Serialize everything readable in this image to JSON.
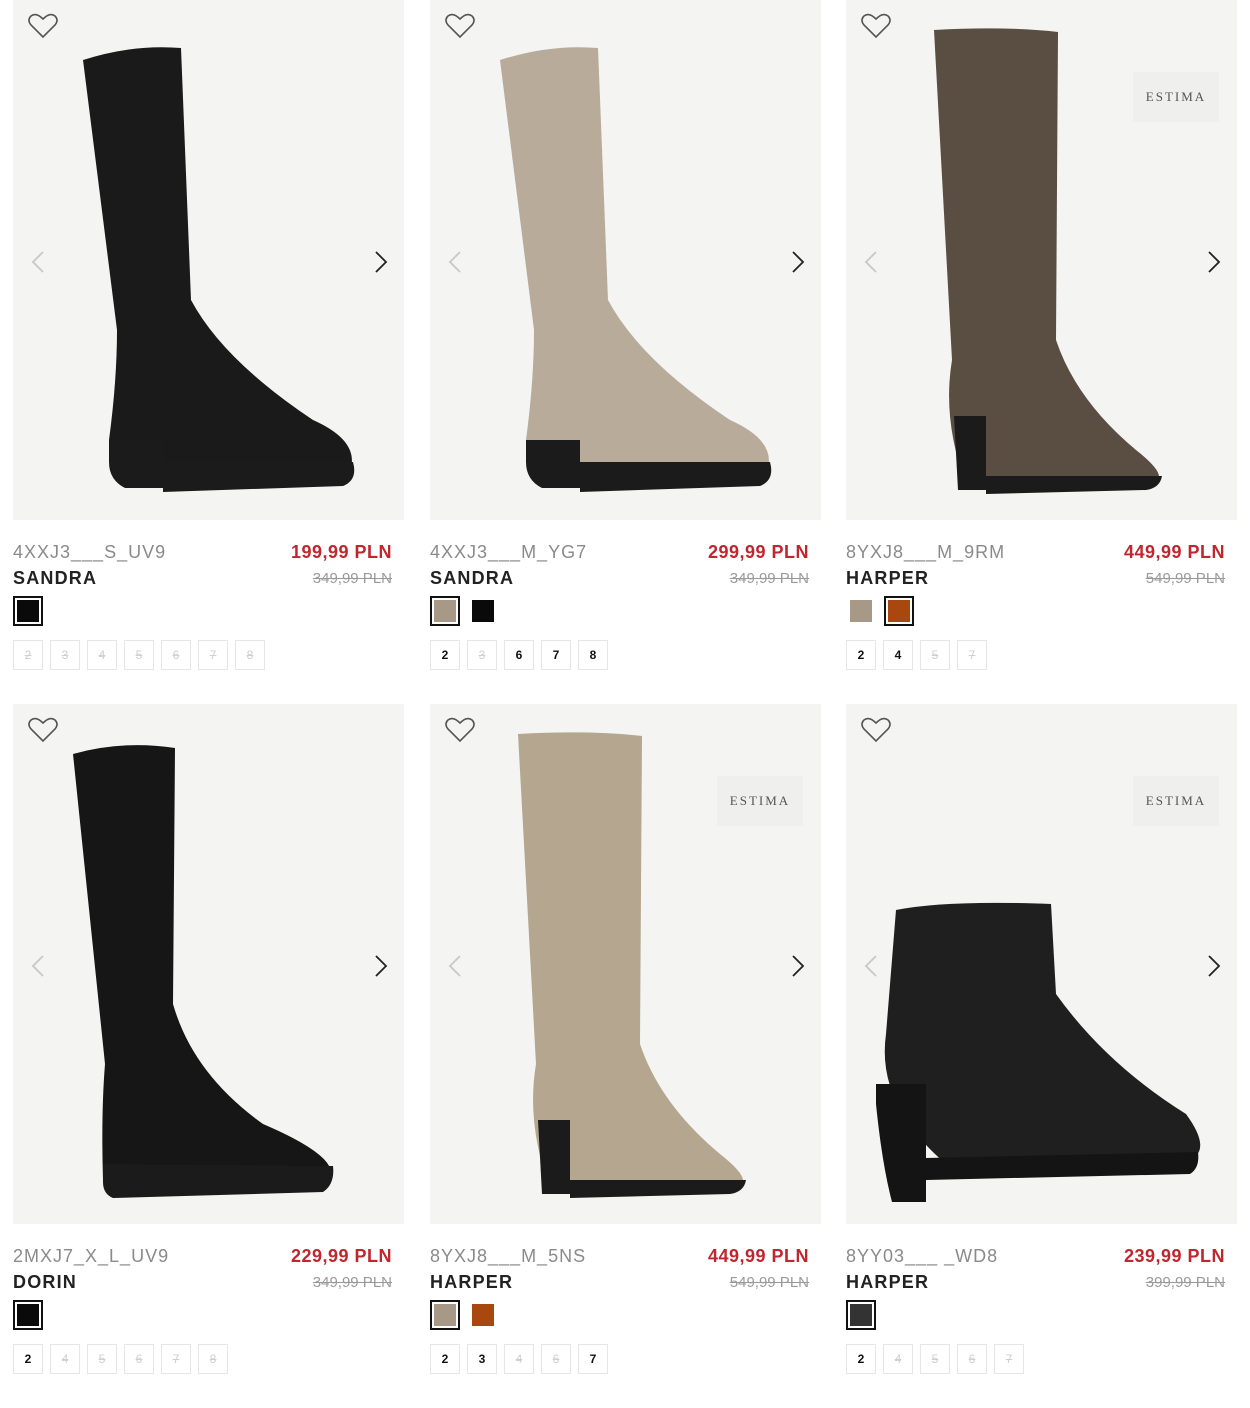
{
  "products": [
    {
      "sku": "4XXJ3___S_UV9",
      "name": "SANDRA",
      "price": "199,99 PLN",
      "old_price": "349,99 PLN",
      "brand_badge": "",
      "boot_color": "#1a1a1a",
      "boot_type": "block-stretch",
      "swatches": [
        {
          "color": "#0a0a0a",
          "selected": true
        }
      ],
      "sizes": [
        {
          "label": "2",
          "available": false
        },
        {
          "label": "3",
          "available": false
        },
        {
          "label": "4",
          "available": false
        },
        {
          "label": "5",
          "available": false
        },
        {
          "label": "6",
          "available": false
        },
        {
          "label": "7",
          "available": false
        },
        {
          "label": "8",
          "available": false
        }
      ]
    },
    {
      "sku": "4XXJ3___M_YG7",
      "name": "SANDRA",
      "price": "299,99 PLN",
      "old_price": "349,99 PLN",
      "brand_badge": "",
      "boot_color": "#b9ab9a",
      "boot_type": "block-stretch",
      "swatches": [
        {
          "color": "#a89986",
          "selected": true
        },
        {
          "color": "#0a0a0a",
          "selected": false
        }
      ],
      "sizes": [
        {
          "label": "2",
          "available": true
        },
        {
          "label": "3",
          "available": false
        },
        {
          "label": "6",
          "available": true
        },
        {
          "label": "7",
          "available": true
        },
        {
          "label": "8",
          "available": true
        }
      ]
    },
    {
      "sku": "8YXJ8___M_9RM",
      "name": "HARPER",
      "price": "449,99 PLN",
      "old_price": "549,99 PLN",
      "brand_badge": "ESTIMA",
      "boot_color": "#5a4d42",
      "boot_type": "heel-tall",
      "swatches": [
        {
          "color": "#a89986",
          "selected": false
        },
        {
          "color": "#a8480e",
          "selected": true
        }
      ],
      "sizes": [
        {
          "label": "2",
          "available": true
        },
        {
          "label": "4",
          "available": true
        },
        {
          "label": "5",
          "available": false
        },
        {
          "label": "7",
          "available": false
        }
      ]
    },
    {
      "sku": "2MXJ7_X_L_UV9",
      "name": "DORIN",
      "price": "229,99 PLN",
      "old_price": "349,99 PLN",
      "brand_badge": "",
      "boot_color": "#161616",
      "boot_type": "flat-stretch",
      "swatches": [
        {
          "color": "#0a0a0a",
          "selected": true
        }
      ],
      "sizes": [
        {
          "label": "2",
          "available": true
        },
        {
          "label": "4",
          "available": false
        },
        {
          "label": "5",
          "available": false
        },
        {
          "label": "6",
          "available": false
        },
        {
          "label": "7",
          "available": false
        },
        {
          "label": "8",
          "available": false
        }
      ]
    },
    {
      "sku": "8YXJ8___M_5NS",
      "name": "HARPER",
      "price": "449,99 PLN",
      "old_price": "549,99 PLN",
      "brand_badge": "ESTIMA",
      "boot_color": "#b4a68f",
      "boot_type": "heel-tall",
      "swatches": [
        {
          "color": "#a89986",
          "selected": true
        },
        {
          "color": "#a8480e",
          "selected": false
        }
      ],
      "sizes": [
        {
          "label": "2",
          "available": true
        },
        {
          "label": "3",
          "available": true
        },
        {
          "label": "4",
          "available": false
        },
        {
          "label": "6",
          "available": false
        },
        {
          "label": "7",
          "available": true
        }
      ]
    },
    {
      "sku": "8YY03___ _WD8",
      "name": "HARPER",
      "price": "239,99 PLN",
      "old_price": "399,99 PLN",
      "brand_badge": "ESTIMA",
      "boot_color": "#1f1f1f",
      "boot_type": "ankle",
      "swatches": [
        {
          "color": "#333333",
          "selected": true
        }
      ],
      "sizes": [
        {
          "label": "2",
          "available": true
        },
        {
          "label": "4",
          "available": false
        },
        {
          "label": "5",
          "available": false
        },
        {
          "label": "6",
          "available": false
        },
        {
          "label": "7",
          "available": false
        }
      ]
    }
  ]
}
